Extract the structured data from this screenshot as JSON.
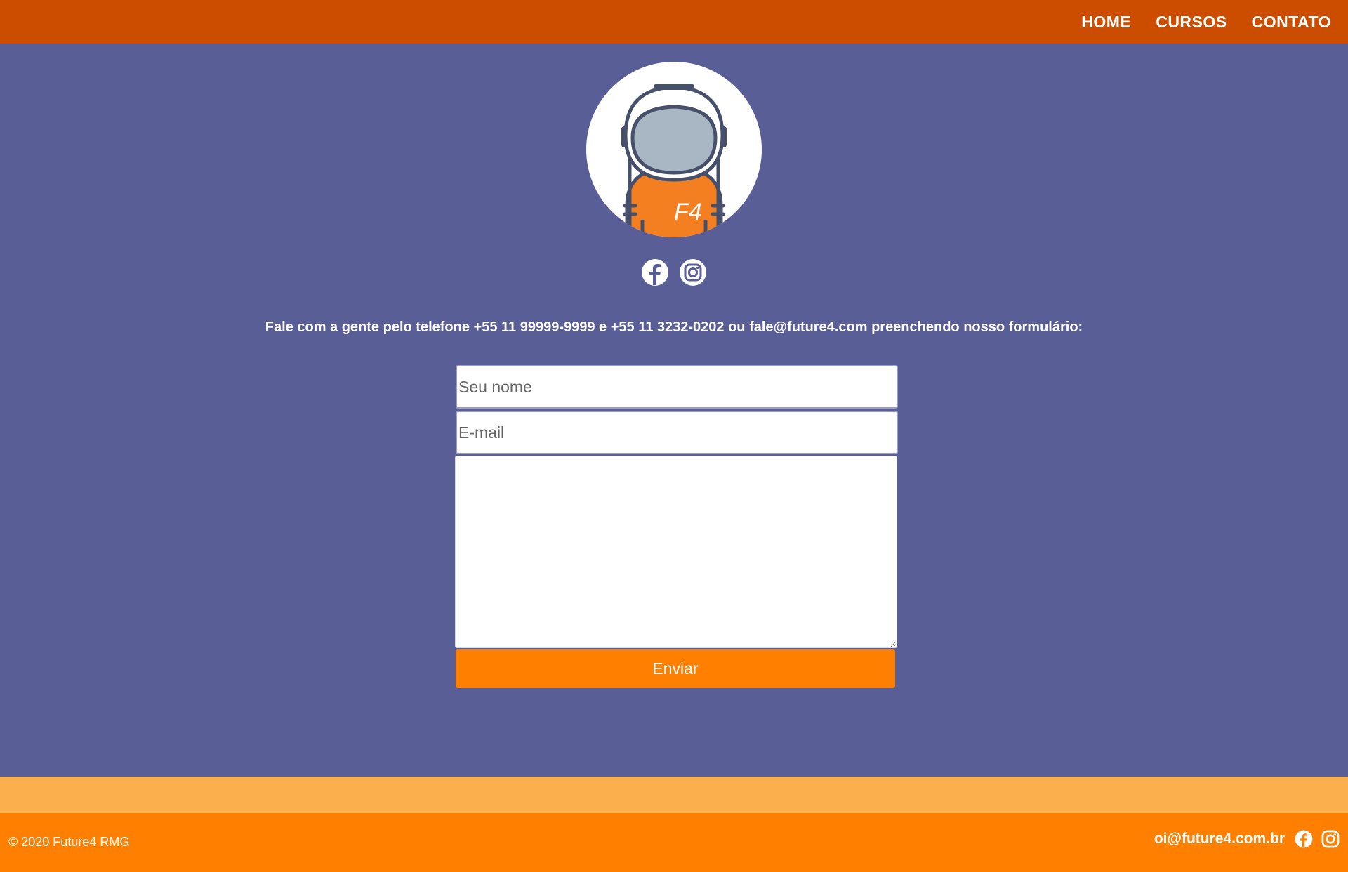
{
  "nav": {
    "items": [
      {
        "label": "HOME"
      },
      {
        "label": "CURSOS"
      },
      {
        "label": "CONTATO"
      }
    ]
  },
  "avatar": {
    "icon": "astronaut-icon",
    "badge": "F4"
  },
  "social": {
    "facebook": "facebook-icon",
    "instagram": "instagram-icon"
  },
  "contact": {
    "text": "Fale com a gente pelo telefone +55 11 99999-9999 e +55 11 3232-0202 ou fale@future4.com preenchendo nosso formulário:"
  },
  "form": {
    "name_placeholder": "Seu nome",
    "email_placeholder": "E-mail",
    "message_value": "",
    "submit_label": "Enviar"
  },
  "footer": {
    "copyright": "© 2020 Future4 RMG",
    "email": "oi@future4.com.br"
  },
  "colors": {
    "header": "#cc4d00",
    "background": "#5a5e96",
    "accent": "#ff7f00",
    "band": "#fbb04d"
  }
}
